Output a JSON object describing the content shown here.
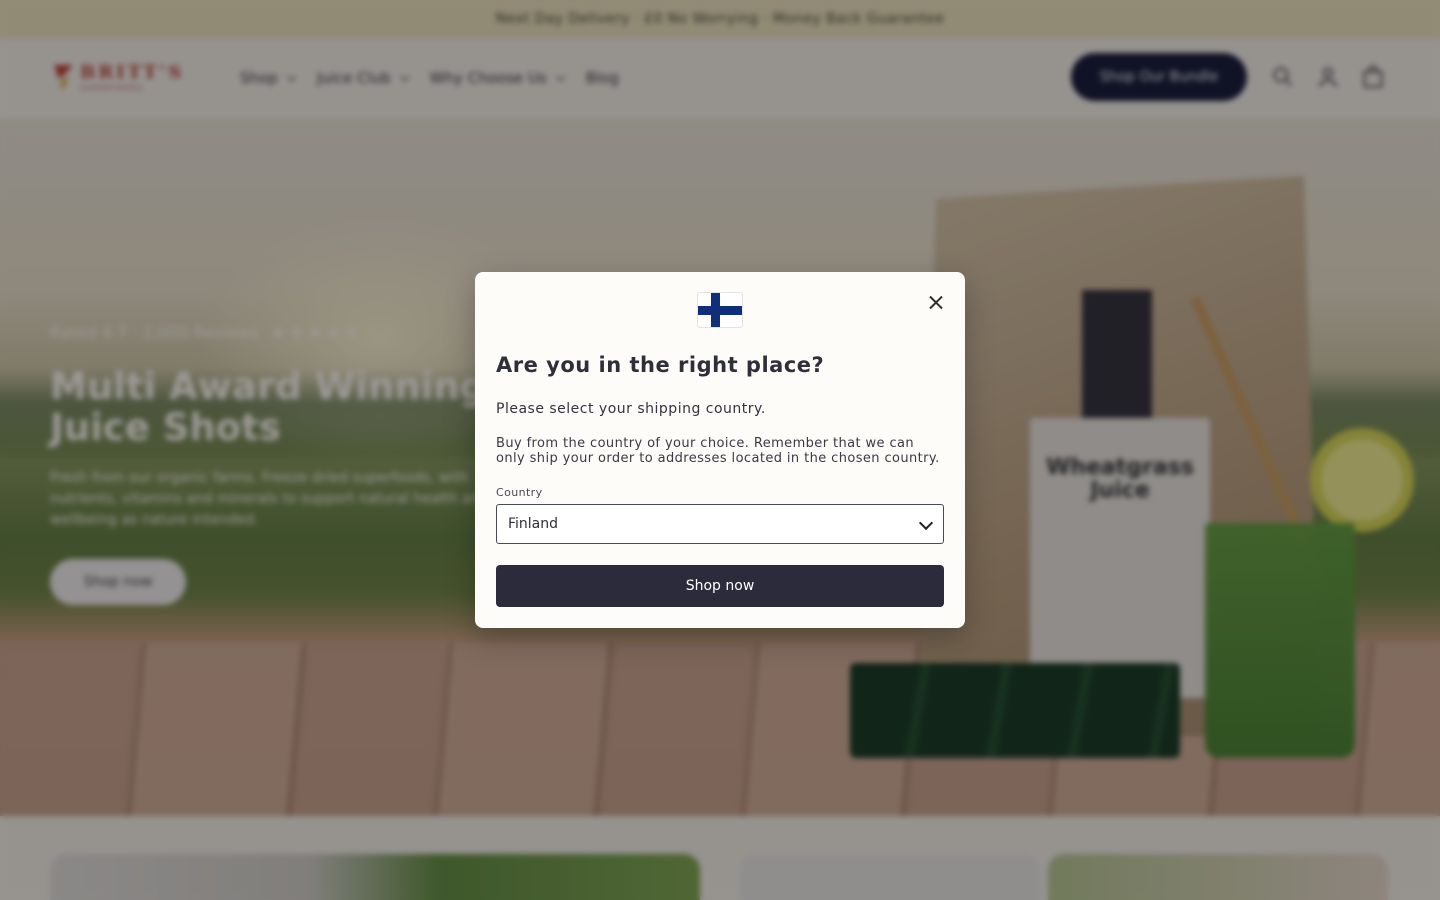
{
  "announcement": "Next Day Delivery · £0 No Worrying · Money Back Guarantee",
  "header": {
    "logo_name": "BRITT'S",
    "logo_sub": "SUPERFOODS",
    "nav": [
      {
        "label": "Shop",
        "has_dropdown": true
      },
      {
        "label": "Juice Club",
        "has_dropdown": true
      },
      {
        "label": "Why Choose Us",
        "has_dropdown": true
      },
      {
        "label": "Blog",
        "has_dropdown": false
      }
    ],
    "cta": "Shop Our Bundle",
    "icons": [
      "search-icon",
      "account-icon",
      "cart-icon"
    ]
  },
  "hero": {
    "reviews": "Rated 4.7 · 2,000 Reviews",
    "stars": "★★★★★",
    "title": "Multi Award Winning Juice Shots",
    "text": "Fresh from our organic farms. Freeze dried superfoods, with nutrients, vitamins and minerals to support natural health and wellbeing as nature intended.",
    "button": "Shop now",
    "product_label": "Wheatgrass Juice"
  },
  "modal": {
    "title": "Are you in the right place?",
    "subtitle": "Please select your shipping country.",
    "description": "Buy from the country of your choice. Remember that we can only ship your order to addresses located in the chosen country.",
    "country_label": "Country",
    "country_value": "Finland",
    "button": "Shop now",
    "flag": "finland-flag-icon"
  },
  "colors": {
    "primary": "#2b2b3c",
    "announcement_bg": "#ede1b8",
    "page_bg": "#f4efe6",
    "flag_blue": "#0f2f7b"
  }
}
